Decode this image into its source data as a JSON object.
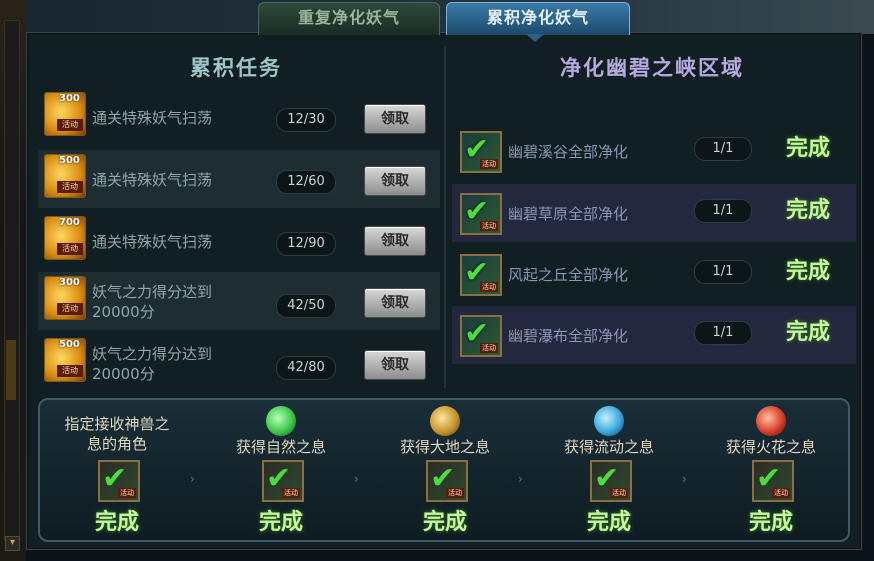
{
  "tabs": {
    "repeat": "重复净化妖气",
    "cumulative": "累积净化妖气"
  },
  "left": {
    "heading": "累积任务",
    "tasks": [
      {
        "amount": "300",
        "tag": "活动",
        "name": "通关特殊妖气扫荡",
        "progress": "12/30",
        "button": "领取"
      },
      {
        "amount": "500",
        "tag": "活动",
        "name": "通关特殊妖气扫荡",
        "progress": "12/60",
        "button": "领取"
      },
      {
        "amount": "700",
        "tag": "活动",
        "name": "通关特殊妖气扫荡",
        "progress": "12/90",
        "button": "领取"
      },
      {
        "amount": "300",
        "tag": "活动",
        "name_line1": "妖气之力得分达到",
        "name_line2": "20000分",
        "progress": "42/50",
        "button": "领取"
      },
      {
        "amount": "500",
        "tag": "活动",
        "name_line1": "妖气之力得分达到",
        "name_line2": "20000分",
        "progress": "42/80",
        "button": "领取"
      }
    ]
  },
  "right": {
    "heading": "净化幽碧之峡区域",
    "areas": [
      {
        "name": "幽碧溪谷全部净化",
        "progress": "1/1",
        "status": "完成",
        "tag": "活动"
      },
      {
        "name": "幽碧草原全部净化",
        "progress": "1/1",
        "status": "完成",
        "tag": "活动"
      },
      {
        "name": "风起之丘全部净化",
        "progress": "1/1",
        "status": "完成",
        "tag": "活动"
      },
      {
        "name": "幽碧瀑布全部净化",
        "progress": "1/1",
        "status": "完成",
        "tag": "活动"
      }
    ]
  },
  "bottom": {
    "steps": [
      {
        "label_line1": "指定接收神兽之",
        "label_line2": "息的角色",
        "status": "完成",
        "tag": "活动"
      },
      {
        "label": "获得自然之息",
        "status": "完成",
        "tag": "活动",
        "orb_color": "#3cc84a"
      },
      {
        "label": "获得大地之息",
        "status": "完成",
        "tag": "活动",
        "orb_color": "#c8962c"
      },
      {
        "label": "获得流动之息",
        "status": "完成",
        "tag": "活动",
        "orb_color": "#3aa8e0"
      },
      {
        "label": "获得火花之息",
        "status": "完成",
        "tag": "活动",
        "orb_color": "#d8402a"
      }
    ],
    "arrow_glyph": "›"
  }
}
